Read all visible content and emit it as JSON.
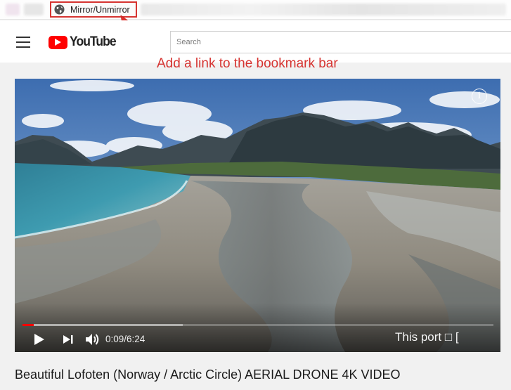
{
  "bookmark_bar": {
    "mirror_label": "Mirror/Unmirror"
  },
  "annotation": {
    "text": "Add a link to the bookmark bar",
    "color": "#d63431"
  },
  "header": {
    "logo_text": "YouTube",
    "search_placeholder": "Search"
  },
  "player": {
    "time": "0:09/6:24",
    "overlay_text": "This port □ [",
    "progress_fraction": 0.024,
    "buffered_fraction": 0.34,
    "accent_color": "#ff0000"
  },
  "video": {
    "title": "Beautiful Lofoten (Norway / Arctic Circle) AERIAL DRONE 4K VIDEO"
  }
}
